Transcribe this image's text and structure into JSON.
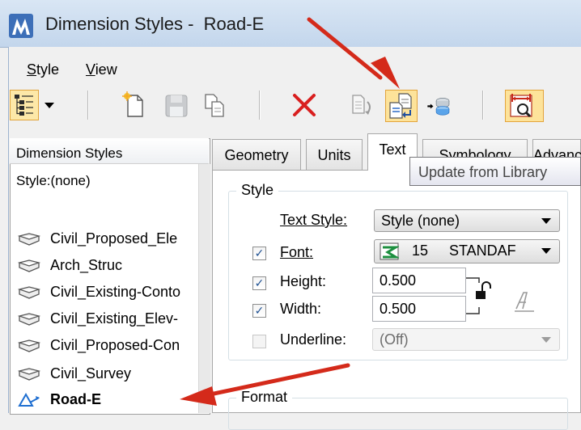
{
  "window": {
    "title": "Dimension Styles -  Road-E"
  },
  "menu": {
    "items": [
      {
        "label": "Style",
        "underline": "S",
        "rest": "tyle"
      },
      {
        "label": "View",
        "underline": "V",
        "rest": "iew"
      }
    ]
  },
  "toolbar": {
    "tooltip": "Update from Library"
  },
  "list_panel": {
    "header": "Dimension Styles",
    "filter": "Style:(none)",
    "items": [
      {
        "label": "Civil_Proposed_Ele",
        "selected": false
      },
      {
        "label": "Arch_Struc",
        "selected": false
      },
      {
        "label": "Civil_Existing-Conto",
        "selected": false
      },
      {
        "label": "Civil_Existing_Elev-",
        "selected": false
      },
      {
        "label": "Civil_Proposed-Con",
        "selected": false
      },
      {
        "label": "Civil_Survey",
        "selected": false
      },
      {
        "label": "Road-E",
        "selected": true
      }
    ]
  },
  "tabs": [
    {
      "label": "Geometry",
      "active": false
    },
    {
      "label": "Units",
      "active": false
    },
    {
      "label": "Text",
      "active": true
    },
    {
      "label": "Symbology",
      "active": false
    },
    {
      "label": "Advanced",
      "active": false
    }
  ],
  "text_tab": {
    "style_group_label": "Style",
    "text_style_label": "Text Style:",
    "text_style_value": "Style (none)",
    "font_label": "Font:",
    "font_checked": true,
    "font_number": "15",
    "font_name": "STANDAF",
    "height_label": "Height:",
    "height_checked": true,
    "height_value": "0.500",
    "width_label": "Width:",
    "width_checked": true,
    "width_value": "0.500",
    "underline_label": "Underline:",
    "underline_checked": false,
    "underline_value": "(Off)",
    "format_group_label": "Format",
    "check_glyph": "✓"
  },
  "colors": {
    "accent": "#e3a43b",
    "annotation_arrow": "#d42a1a",
    "selected_icon": "#1f6fd1"
  }
}
